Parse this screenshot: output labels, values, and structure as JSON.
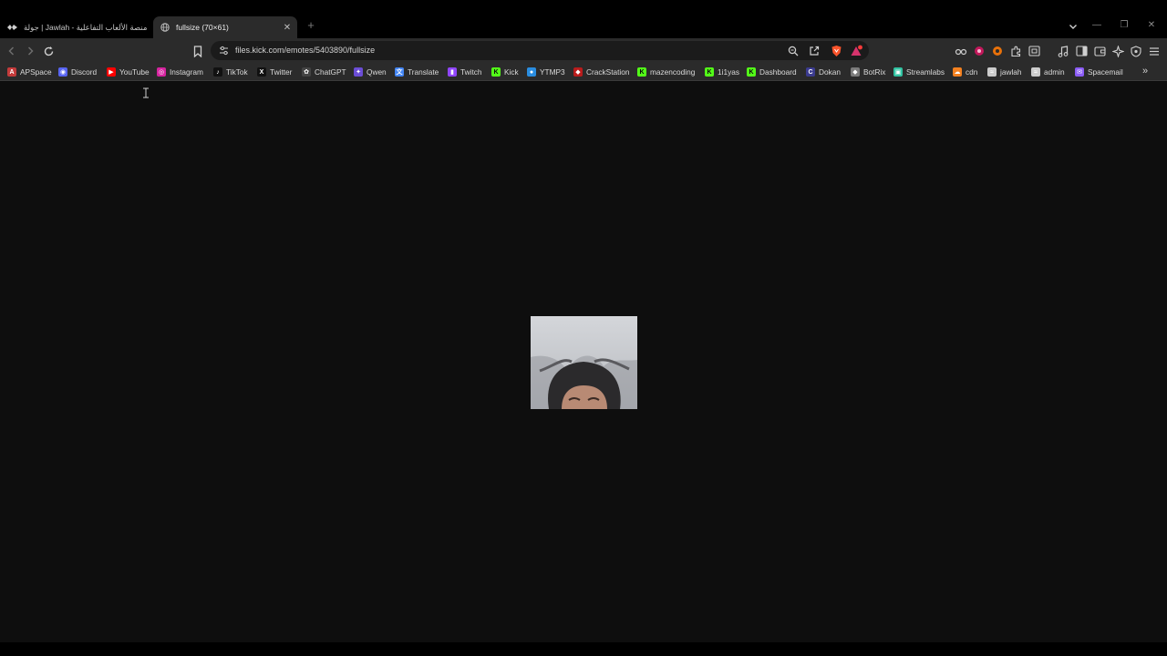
{
  "tabs": [
    {
      "title": "جولة | Jawlah - منصة الألعاب التفاعلية",
      "active": false
    },
    {
      "title": "fullsize (70×61)",
      "active": true
    }
  ],
  "address_bar": {
    "url": "files.kick.com/emotes/5403890/fullsize"
  },
  "shield_badge": "",
  "bookmarks": [
    {
      "label": "APSpace",
      "icon": "apspace-icon",
      "color": "#c43b3b"
    },
    {
      "label": "Discord",
      "icon": "discord-icon",
      "color": "#5865f2"
    },
    {
      "label": "YouTube",
      "icon": "youtube-icon",
      "color": "#ff0000"
    },
    {
      "label": "Instagram",
      "icon": "instagram-icon",
      "color": "#d6249f"
    },
    {
      "label": "TikTok",
      "icon": "tiktok-icon",
      "color": "#111111"
    },
    {
      "label": "Twitter",
      "icon": "x-icon",
      "color": "#111111"
    },
    {
      "label": "ChatGPT",
      "icon": "chatgpt-icon",
      "color": "#444444"
    },
    {
      "label": "Qwen",
      "icon": "qwen-icon",
      "color": "#6b4dd6"
    },
    {
      "label": "Translate",
      "icon": "translate-icon",
      "color": "#4285f4"
    },
    {
      "label": "Twitch",
      "icon": "twitch-icon",
      "color": "#9146ff"
    },
    {
      "label": "Kick",
      "icon": "kick-icon",
      "color": "#53fc18"
    },
    {
      "label": "YTMP3",
      "icon": "ytmp3-icon",
      "color": "#2a8de0"
    },
    {
      "label": "CrackStation",
      "icon": "crackstation-icon",
      "color": "#b91c1c"
    },
    {
      "label": "mazencoding",
      "icon": "kick-icon",
      "color": "#53fc18"
    },
    {
      "label": "1i1yas",
      "icon": "kick-icon",
      "color": "#53fc18"
    },
    {
      "label": "Dashboard",
      "icon": "kick-icon",
      "color": "#53fc18"
    },
    {
      "label": "Dokan",
      "icon": "dokan-icon",
      "color": "#3b3b8f"
    },
    {
      "label": "BotRix",
      "icon": "botrix-icon",
      "color": "#7c7c7c"
    },
    {
      "label": "Streamlabs",
      "icon": "streamlabs-icon",
      "color": "#31c3a2"
    },
    {
      "label": "cdn",
      "icon": "cdn-icon",
      "color": "#f48120"
    },
    {
      "label": "jawlah",
      "icon": "jawlah-icon",
      "color": "#cccccc"
    },
    {
      "label": "admin",
      "icon": "jawlah-icon",
      "color": "#cccccc"
    },
    {
      "label": "Spacemail",
      "icon": "spacemail-icon",
      "color": "#8b5cf6"
    }
  ],
  "accent": "#fb542b"
}
